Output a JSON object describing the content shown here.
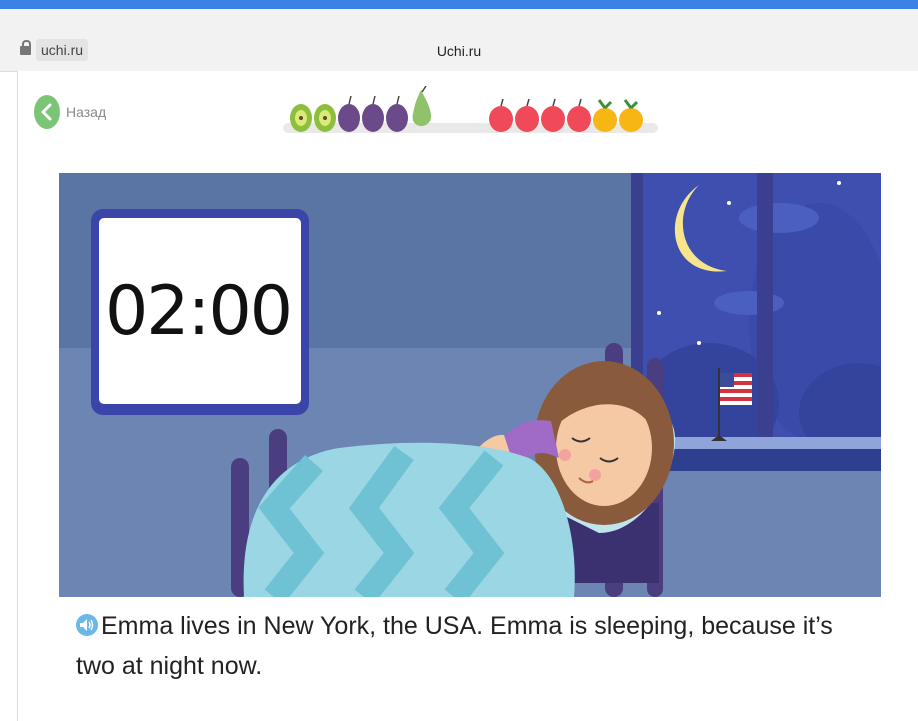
{
  "browser": {
    "url": "uchi.ru",
    "tab_title": "Uchi.ru"
  },
  "nav": {
    "back_label": "Назад"
  },
  "progress": {
    "fruits": [
      "kiwi",
      "kiwi",
      "plum",
      "plum",
      "plum",
      "pear",
      "apple",
      "apple",
      "apple",
      "apple",
      "orange",
      "orange"
    ]
  },
  "scene": {
    "clock_time": "02:00"
  },
  "sentence": {
    "text": "Emma lives in New York, the USA. Emma is sleeping, because it’s two at night now."
  },
  "colors": {
    "accent_blue": "#3b82e6",
    "back_green": "#7cc576",
    "wall": "#6b82ad",
    "night_sky": "#3e4fb0"
  }
}
